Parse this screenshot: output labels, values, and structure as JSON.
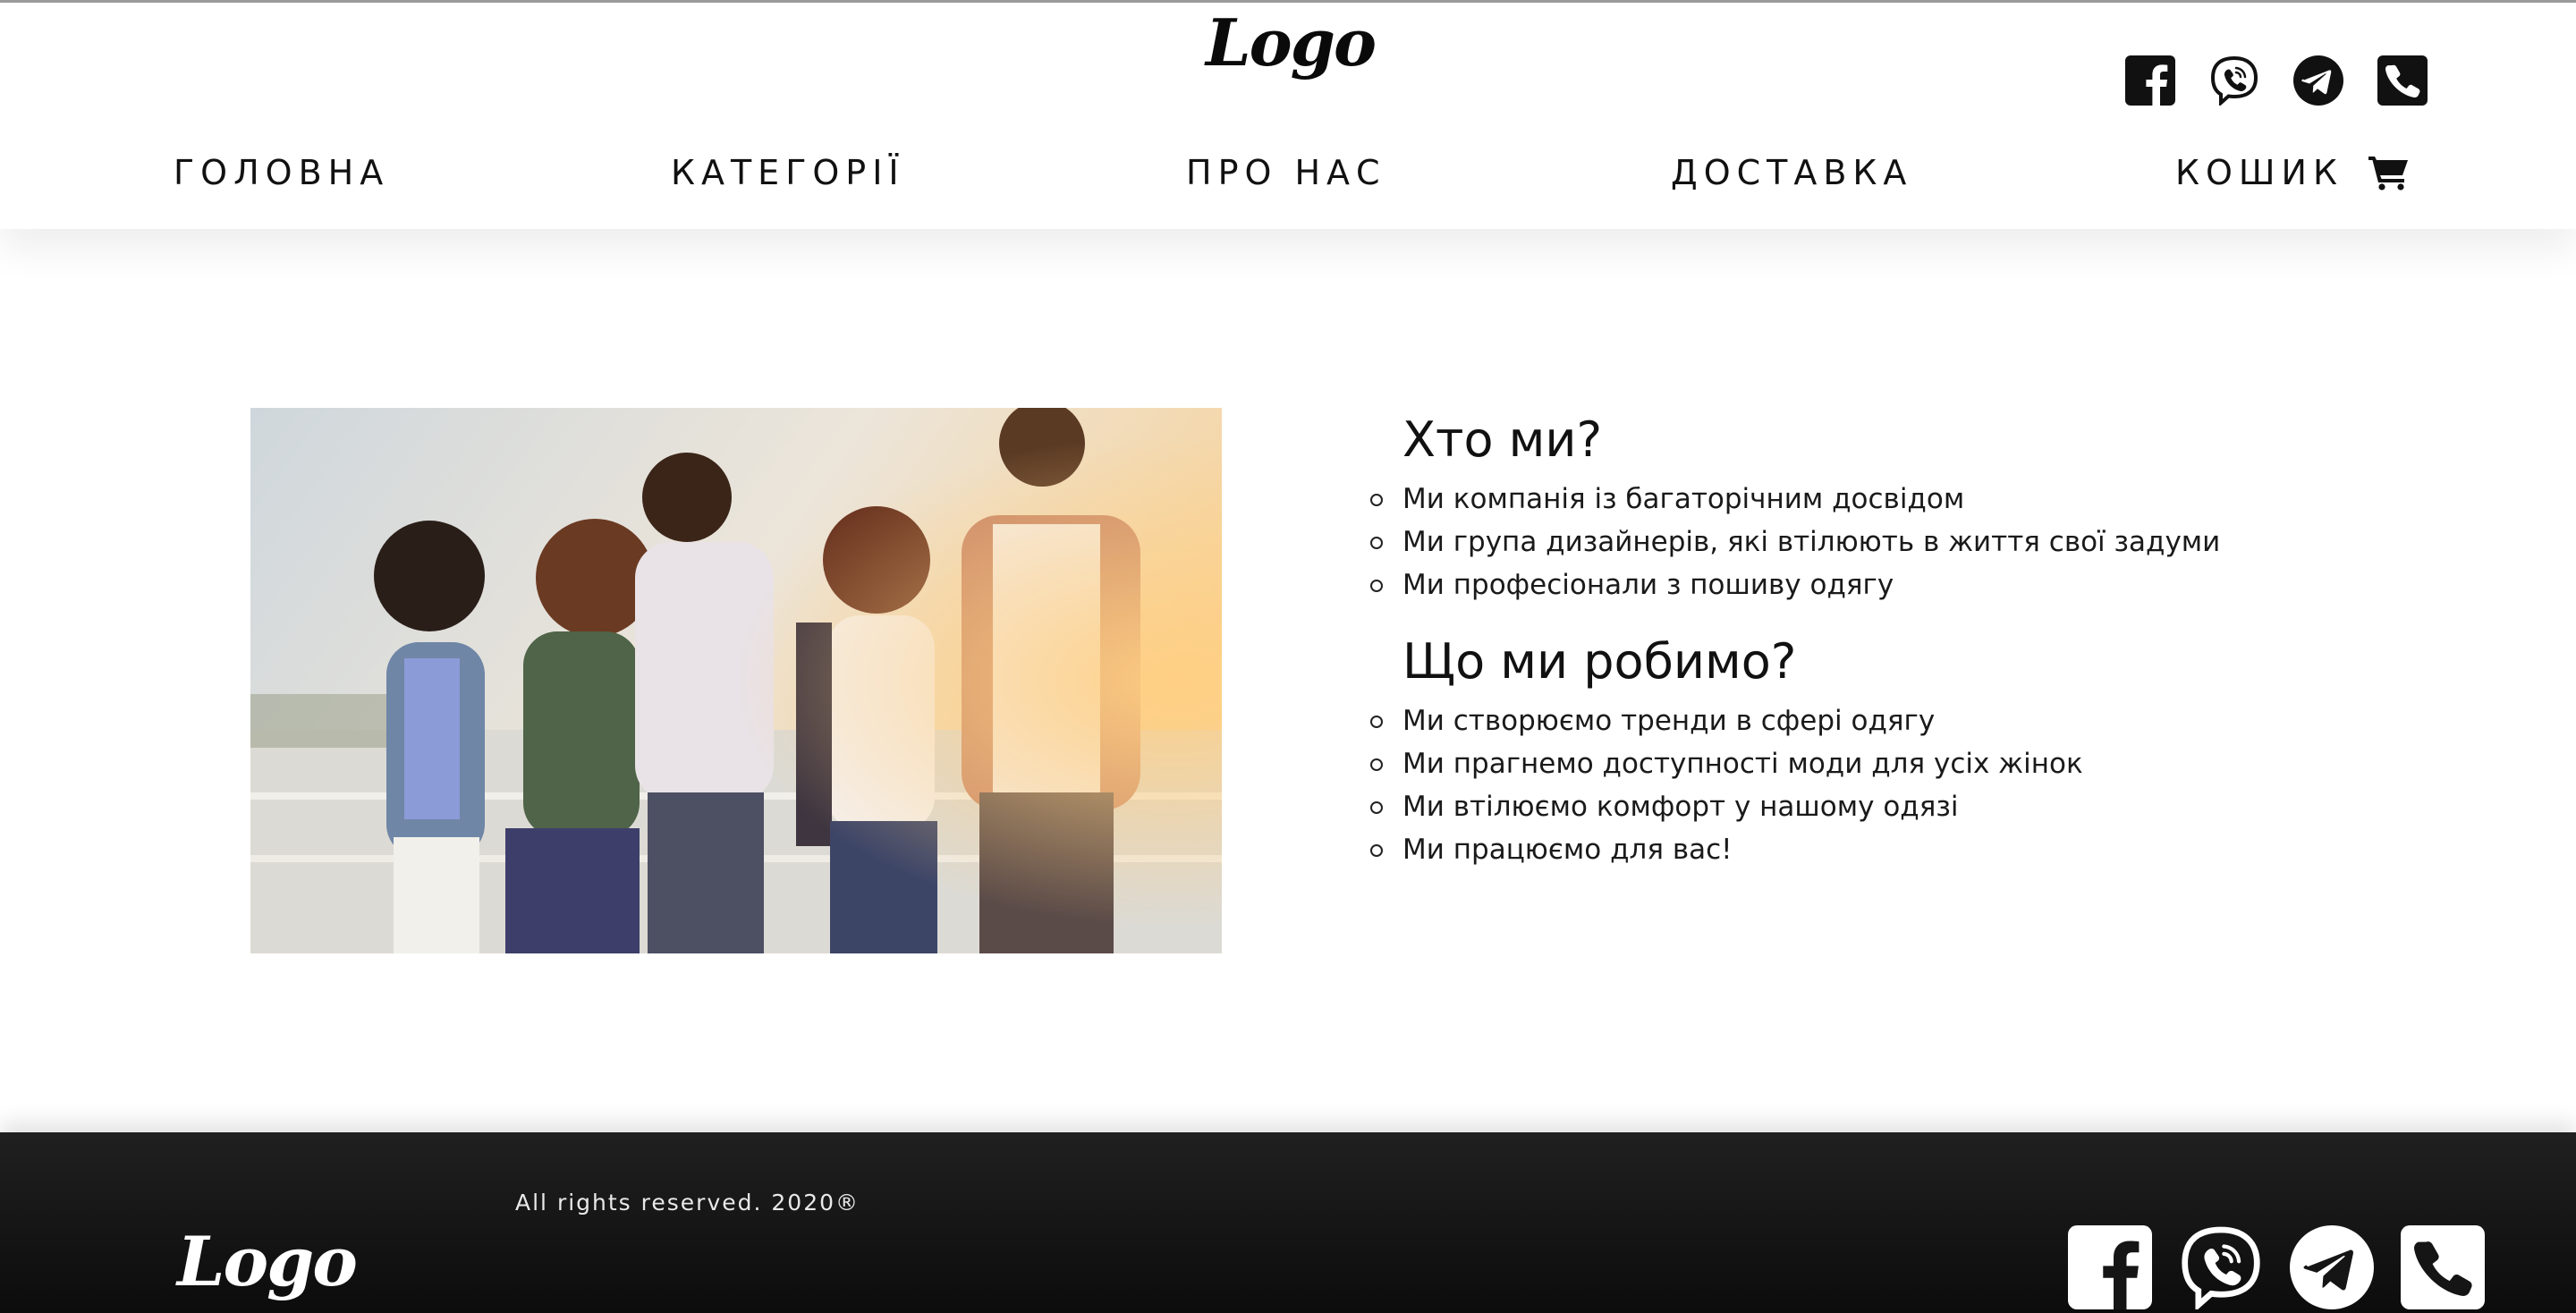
{
  "header": {
    "logo": "Logo",
    "social": [
      "facebook-icon",
      "viber-icon",
      "telegram-icon",
      "phone-icon"
    ],
    "nav": [
      {
        "label": "ГОЛОВНА"
      },
      {
        "label": "КАТЕГОРІЇ"
      },
      {
        "label": "ПРО НАС"
      },
      {
        "label": "ДОСТАВКА"
      },
      {
        "label": "КОШИК",
        "icon": "cart-icon"
      }
    ]
  },
  "main": {
    "who": {
      "title": "Хто ми?",
      "items": [
        "Ми компанія із багаторічним досвідом",
        "Ми група дизайнерів, які втілюють в життя свої задуми",
        "Ми професіонали з пошиву одягу"
      ]
    },
    "what": {
      "title": "Що ми робимо?",
      "items": [
        "Ми створюємо тренди в сфері одягу",
        "Ми прагнемо доступності моди для усіх жінок",
        "Ми втілюємо комфорт у нашому одязі",
        "Ми працюємо для вас!"
      ]
    }
  },
  "footer": {
    "logo": "Logo",
    "copyright": "All rights reserved. 2020®",
    "social": [
      "facebook-icon",
      "viber-icon",
      "telegram-icon",
      "phone-icon"
    ]
  },
  "colors": {
    "header_bg": "#ffffff",
    "footer_bg": "#161616",
    "text": "#111111"
  }
}
